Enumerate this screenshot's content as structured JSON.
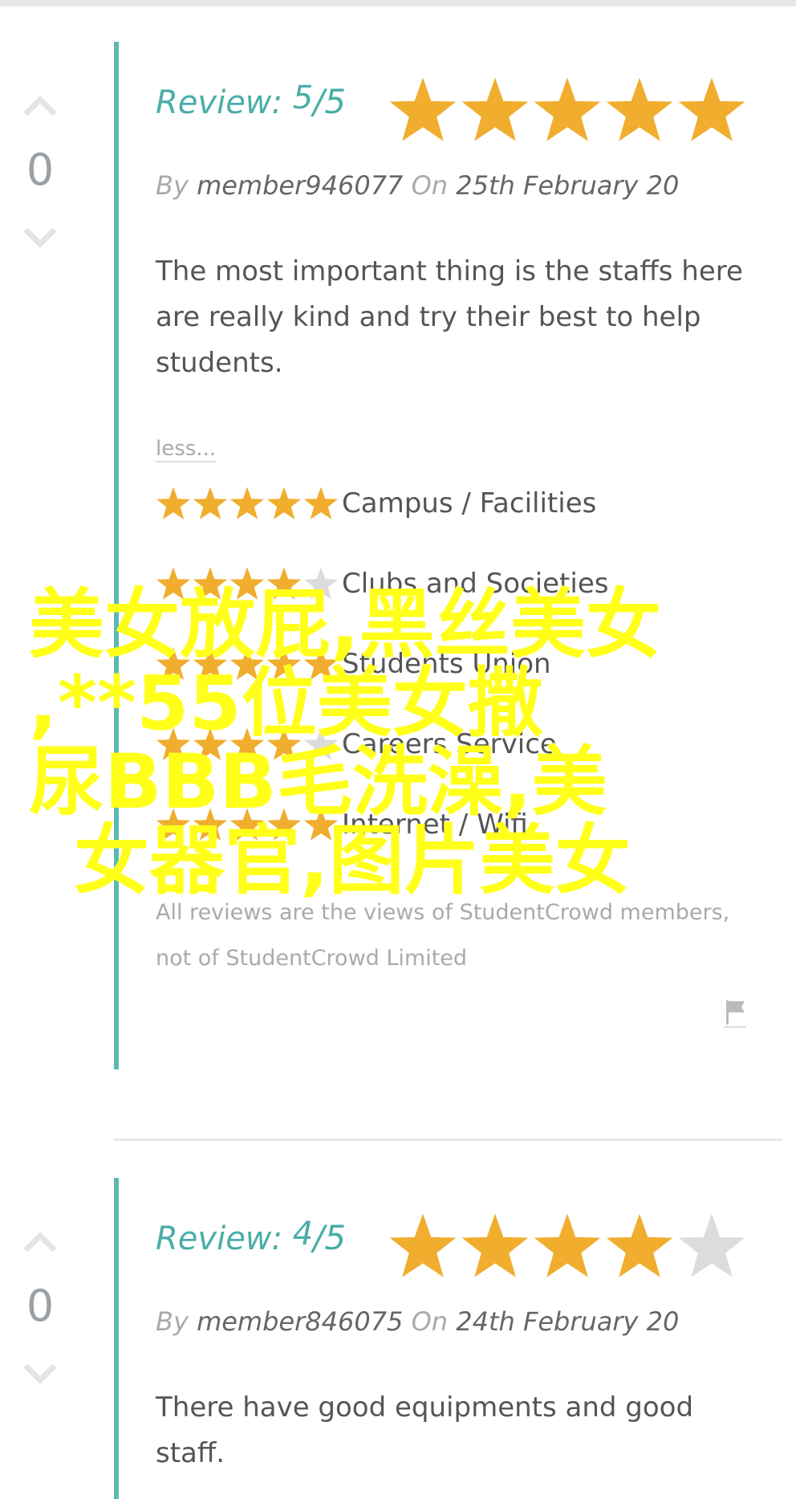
{
  "reviews": [
    {
      "votes": "0",
      "review_label": "Review:",
      "score": "5",
      "out_of": "/5",
      "overall_stars": 5,
      "by_label": "By",
      "author": "member946077",
      "on_label": "On",
      "date": "25th February 20",
      "text": "The most important thing is the staffs here are really kind and try their best to help students.",
      "less_link": "less...",
      "categories": [
        {
          "label": "Campus / Facilities",
          "stars": 5
        },
        {
          "label": "Clubs and Societies",
          "stars": 4
        },
        {
          "label": "Students Union",
          "stars": 5
        },
        {
          "label": "Careers Service",
          "stars": 4
        },
        {
          "label": "Internet / Wifi",
          "stars": 5
        }
      ],
      "disclaimer": "All reviews are the views of StudentCrowd members, not of StudentCrowd Limited"
    },
    {
      "votes": "0",
      "review_label": "Review:",
      "score": "4",
      "out_of": "/5",
      "overall_stars": 4,
      "by_label": "By",
      "author": "member846075",
      "on_label": "On",
      "date": "24th February 20",
      "text": "There have good equipments and good staff."
    }
  ],
  "overlay": {
    "line1": "美女放屁,黑丝美女",
    "line2": ",**55位美女撒",
    "line3": "尿BBB毛洗澡,美",
    "line4": "女器官,图片美女"
  },
  "colors": {
    "star_on": "#f0ad2e",
    "star_off": "#dcdcdc",
    "accent": "#4aaea7",
    "overlay": "#ffff1a"
  },
  "icons": {
    "upvote": "chevron-up-icon",
    "downvote": "chevron-down-icon",
    "report": "flag-icon",
    "star": "star-icon"
  }
}
